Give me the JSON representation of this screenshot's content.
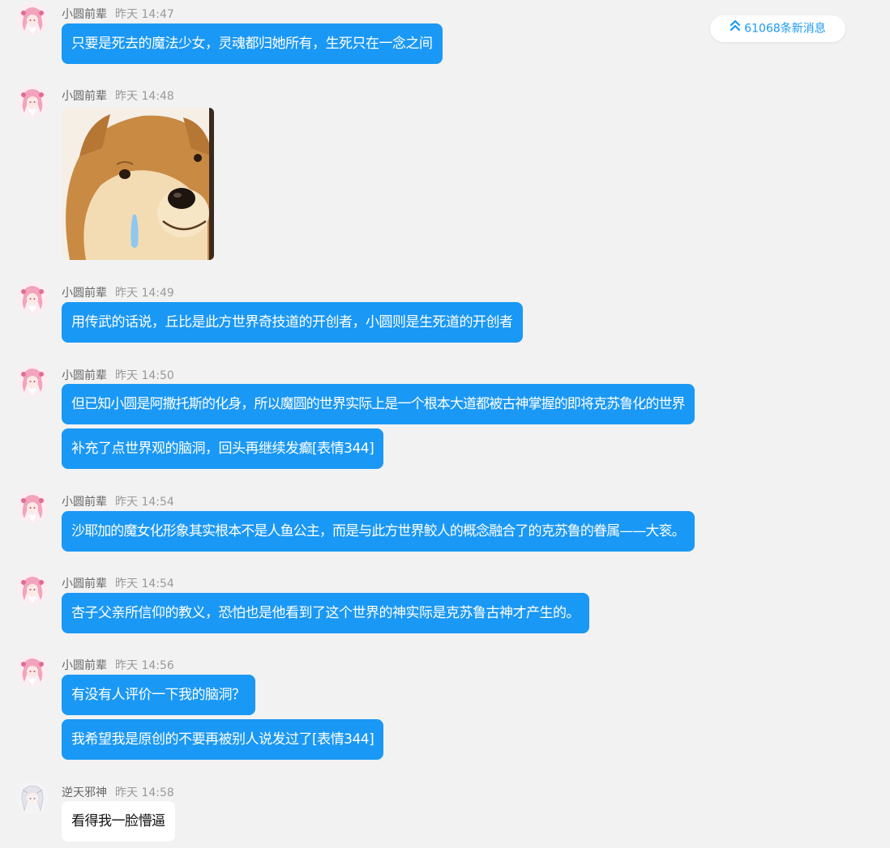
{
  "new_messages": {
    "label": "61068条新消息",
    "icon": "double-chevron-up-icon",
    "color": "#1a98f5"
  },
  "messages": [
    {
      "sender": "小圆前辈",
      "time": "昨天 14:47",
      "avatar": "pink-anime-girl-avatar",
      "bubbles": [
        "只要是死去的魔法少女，灵魂都归她所有，生死只在一念之间"
      ]
    },
    {
      "sender": "小圆前辈",
      "time": "昨天 14:48",
      "avatar": "pink-anime-girl-avatar",
      "sticker": "shiba-dog-drooling-sticker"
    },
    {
      "sender": "小圆前辈",
      "time": "昨天 14:49",
      "avatar": "pink-anime-girl-avatar",
      "bubbles": [
        "用传武的话说，丘比是此方世界奇技道的开创者，小圆则是生死道的开创者"
      ]
    },
    {
      "sender": "小圆前辈",
      "time": "昨天 14:50",
      "avatar": "pink-anime-girl-avatar",
      "bubbles": [
        "但已知小圆是阿撒托斯的化身，所以魔圆的世界实际上是一个根本大道都被古神掌握的即将克苏鲁化的世界",
        "补充了点世界观的脑洞，回头再继续发癫[表情344]"
      ]
    },
    {
      "sender": "小圆前辈",
      "time": "昨天 14:54",
      "avatar": "pink-anime-girl-avatar",
      "bubbles": [
        "沙耶加的魔女化形象其实根本不是人鱼公主，而是与此方世界鲛人的概念融合了的克苏鲁的眷属——大衮。"
      ]
    },
    {
      "sender": "小圆前辈",
      "time": "昨天 14:54",
      "avatar": "pink-anime-girl-avatar",
      "bubbles": [
        "杏子父亲所信仰的教义，恐怕也是他看到了这个世界的神实际是克苏鲁古神才产生的。"
      ]
    },
    {
      "sender": "小圆前辈",
      "time": "昨天 14:56",
      "avatar": "pink-anime-girl-avatar",
      "bubbles": [
        "有没有人评价一下我的脑洞？",
        "我希望我是原创的不要再被别人说发过了[表情344]"
      ]
    },
    {
      "sender": "逆天邪神",
      "time": "昨天 14:58",
      "avatar": "white-hair-anime-avatar",
      "bubbles": [
        "看得我一脸懵逼"
      ]
    }
  ],
  "colors": {
    "background": "#f2f2f2",
    "bubble_blue": "#1a98f5",
    "bubble_white": "#ffffff"
  }
}
